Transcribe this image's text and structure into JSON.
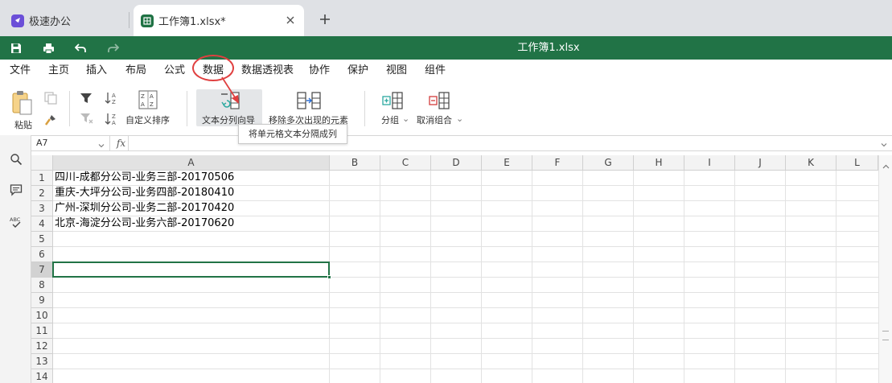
{
  "tabs": [
    {
      "label": "极速办公",
      "icon": "app-logo-icon",
      "active": false
    },
    {
      "label": "工作簿1.xlsx*",
      "icon": "spreadsheet-icon",
      "active": true
    }
  ],
  "quickbar": {
    "doc_title": "工作簿1.xlsx",
    "bg_color": "#217346"
  },
  "menu": {
    "items": [
      "文件",
      "主页",
      "插入",
      "布局",
      "公式",
      "数据",
      "数据透视表",
      "协作",
      "保护",
      "视图",
      "组件"
    ],
    "highlighted": "数据"
  },
  "ribbon": {
    "paste": "粘贴",
    "custom_sort": "自定义排序",
    "text_to_columns": "文本分列向导",
    "remove_duplicates": "移除多次出现的元素",
    "group": "分组",
    "ungroup": "取消组合",
    "tooltip": "将单元格文本分隔成列"
  },
  "formula_bar": {
    "name_box": "A7",
    "fx_label": "fx",
    "formula": ""
  },
  "columns": [
    "A",
    "B",
    "C",
    "D",
    "E",
    "F",
    "G",
    "H",
    "I",
    "J",
    "K",
    "L"
  ],
  "rows": [
    "1",
    "2",
    "3",
    "4",
    "5",
    "6",
    "7",
    "8",
    "9",
    "10",
    "11",
    "12",
    "13",
    "14"
  ],
  "cells": {
    "A1": "四川-成都分公司-业务三部-20170506",
    "A2": "重庆-大坪分公司-业务四部-20180410",
    "A3": "广州-深圳分公司-业务二部-20170420",
    "A4": "北京-海淀分公司-业务六部-20170620"
  },
  "selected_cell": "A7",
  "colors": {
    "accent_green": "#217346",
    "annotation_red": "#e04040",
    "app_purple": "#6b4fd8"
  }
}
